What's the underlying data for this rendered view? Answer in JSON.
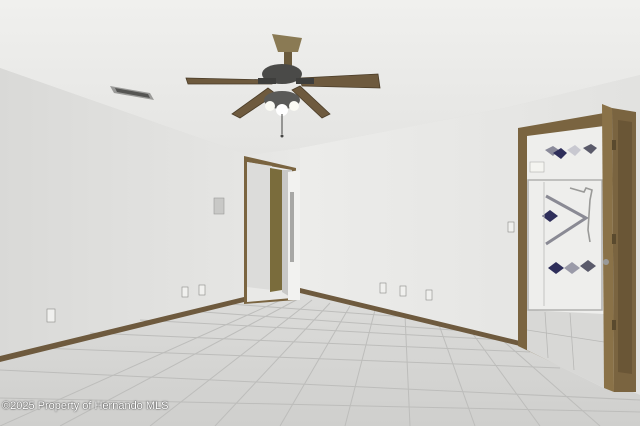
{
  "photo": {
    "watermark": "©2025 Property of Hernando MLS"
  },
  "colors": {
    "wall": "#e6e6e4",
    "ceiling": "#ececea",
    "floor_tile": "#d6d6d4",
    "baseboard": "#6e5a3e",
    "door_trim": "#7a6440"
  }
}
